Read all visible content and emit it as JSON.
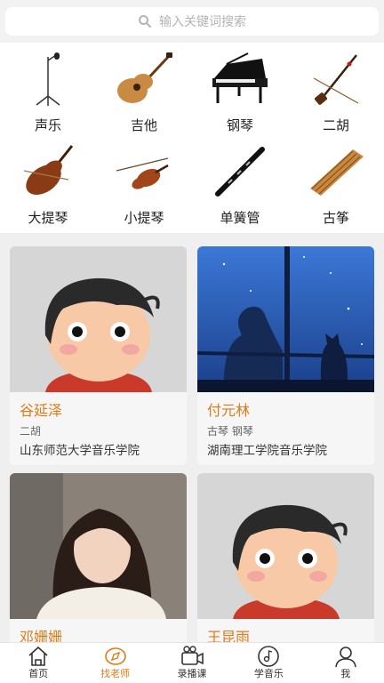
{
  "search": {
    "placeholder": "输入关键词搜索",
    "icon": "search-icon"
  },
  "categories": [
    {
      "label": "声乐",
      "icon": "microphone-icon"
    },
    {
      "label": "吉他",
      "icon": "guitar-icon"
    },
    {
      "label": "钢琴",
      "icon": "piano-icon"
    },
    {
      "label": "二胡",
      "icon": "erhu-icon"
    },
    {
      "label": "大提琴",
      "icon": "cello-icon"
    },
    {
      "label": "小提琴",
      "icon": "violin-icon"
    },
    {
      "label": "单簧管",
      "icon": "clarinet-icon"
    },
    {
      "label": "古筝",
      "icon": "guzheng-icon"
    }
  ],
  "teachers": [
    {
      "name": "谷延泽",
      "instruments": "二胡",
      "school": "山东师范大学音乐学院"
    },
    {
      "name": "付元林",
      "instruments": "古琴 钢琴",
      "school": "湖南理工学院音乐学院"
    },
    {
      "name": "邓姗姗",
      "instruments": "",
      "school": ""
    },
    {
      "name": "王昆雨",
      "instruments": "",
      "school": ""
    }
  ],
  "tabbar": [
    {
      "label": "首页",
      "icon": "home-icon",
      "active": false
    },
    {
      "label": "找老师",
      "icon": "compass-icon",
      "active": true
    },
    {
      "label": "录播课",
      "icon": "video-camera-icon",
      "active": false
    },
    {
      "label": "学音乐",
      "icon": "music-disc-icon",
      "active": false
    },
    {
      "label": "我",
      "icon": "user-icon",
      "active": false
    }
  ],
  "colors": {
    "accent": "#e07a18",
    "text": "#222222",
    "muted": "#666666",
    "background": "#efefef"
  }
}
